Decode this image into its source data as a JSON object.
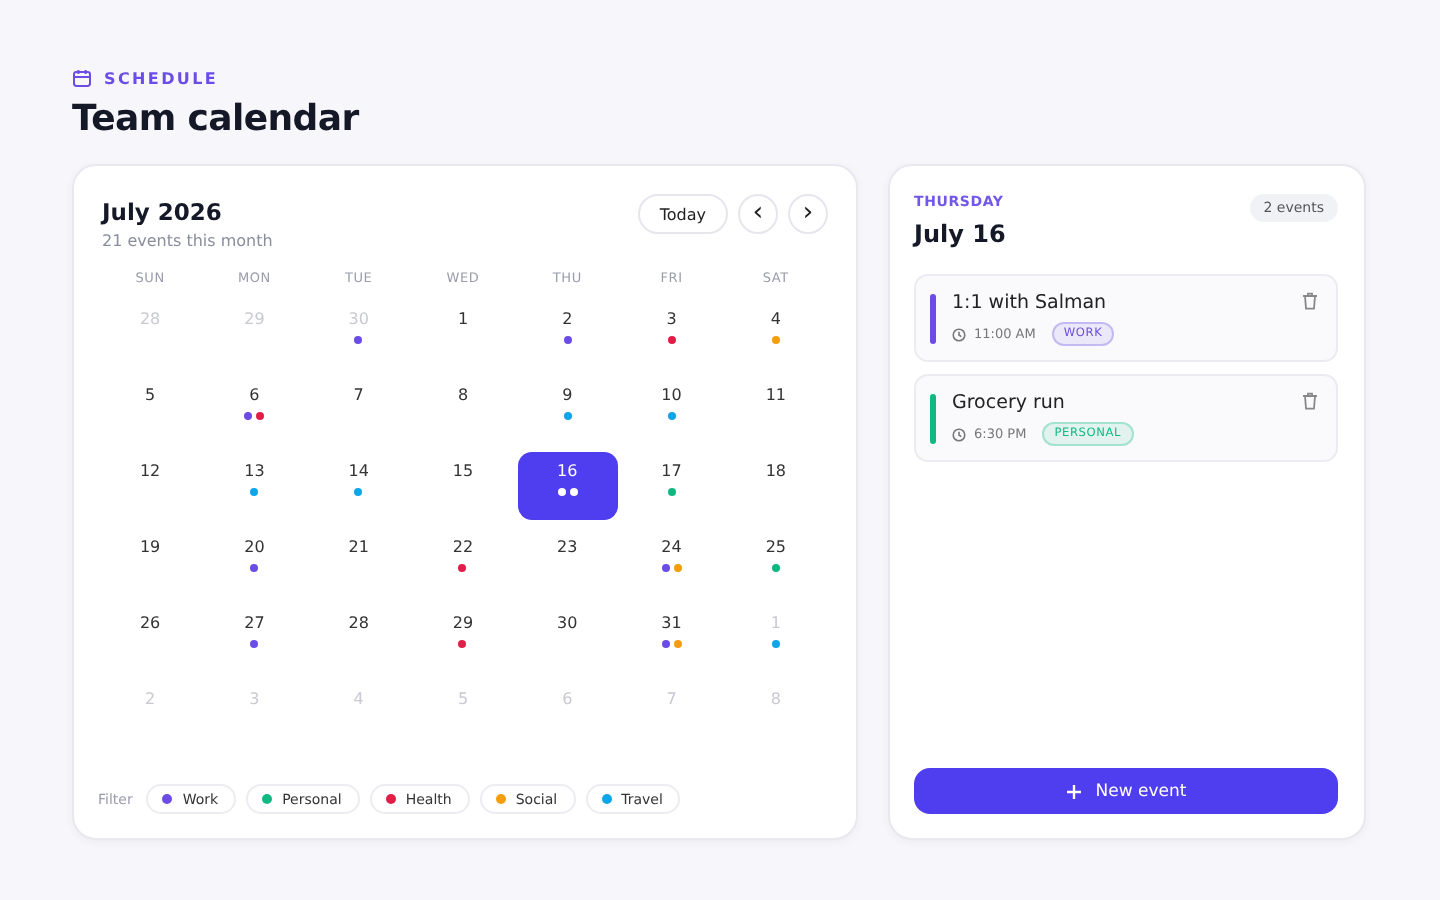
{
  "header": {
    "eyebrow": "SCHEDULE",
    "title": "Team calendar"
  },
  "calendar": {
    "month": "July 2026",
    "summary": "21 events this month",
    "today_button": "Today",
    "prev": "‹",
    "next": "›",
    "weekdays": [
      "SUN",
      "MON",
      "TUE",
      "WED",
      "THU",
      "FRI",
      "SAT"
    ],
    "days": [
      {
        "label": "28",
        "muted": true,
        "selected": false
      },
      {
        "label": "29",
        "muted": true,
        "selected": false
      },
      {
        "label": "30",
        "muted": true,
        "selected": false,
        "dots": [
          {
            "color": "#6c4ce6"
          }
        ]
      },
      {
        "label": "1",
        "muted": false,
        "selected": false
      },
      {
        "label": "2",
        "muted": false,
        "selected": false,
        "dots": [
          {
            "color": "#6c4ce6"
          }
        ]
      },
      {
        "label": "3",
        "muted": false,
        "selected": false,
        "dots": [
          {
            "color": "#e11d48"
          }
        ]
      },
      {
        "label": "4",
        "muted": false,
        "selected": false,
        "dots": [
          {
            "color": "#f59e0b"
          }
        ]
      },
      {
        "label": "5",
        "muted": false,
        "selected": false
      },
      {
        "label": "6",
        "muted": false,
        "selected": false,
        "dots": [
          {
            "color": "#6c4ce6"
          },
          {
            "color": "#e11d48"
          }
        ]
      },
      {
        "label": "7",
        "muted": false,
        "selected": false
      },
      {
        "label": "8",
        "muted": false,
        "selected": false
      },
      {
        "label": "9",
        "muted": false,
        "selected": false,
        "dots": [
          {
            "color": "#0ea5e9"
          }
        ]
      },
      {
        "label": "10",
        "muted": false,
        "selected": false,
        "dots": [
          {
            "color": "#0ea5e9"
          }
        ]
      },
      {
        "label": "11",
        "muted": false,
        "selected": false
      },
      {
        "label": "12",
        "muted": false,
        "selected": false
      },
      {
        "label": "13",
        "muted": false,
        "selected": false,
        "dots": [
          {
            "color": "#0ea5e9"
          }
        ]
      },
      {
        "label": "14",
        "muted": false,
        "selected": false,
        "dots": [
          {
            "color": "#0ea5e9"
          }
        ]
      },
      {
        "label": "15",
        "muted": false,
        "selected": false
      },
      {
        "label": "16",
        "muted": false,
        "selected": true,
        "dots": [
          {
            "color": "#ffffff"
          },
          {
            "color": "#ffffff"
          }
        ]
      },
      {
        "label": "17",
        "muted": false,
        "selected": false,
        "dots": [
          {
            "color": "#10b981"
          }
        ]
      },
      {
        "label": "18",
        "muted": false,
        "selected": false
      },
      {
        "label": "19",
        "muted": false,
        "selected": false
      },
      {
        "label": "20",
        "muted": false,
        "selected": false,
        "dots": [
          {
            "color": "#6c4ce6"
          }
        ]
      },
      {
        "label": "21",
        "muted": false,
        "selected": false
      },
      {
        "label": "22",
        "muted": false,
        "selected": false,
        "dots": [
          {
            "color": "#e11d48"
          }
        ]
      },
      {
        "label": "23",
        "muted": false,
        "selected": false
      },
      {
        "label": "24",
        "muted": false,
        "selected": false,
        "dots": [
          {
            "color": "#6c4ce6"
          },
          {
            "color": "#f59e0b"
          }
        ]
      },
      {
        "label": "25",
        "muted": false,
        "selected": false,
        "dots": [
          {
            "color": "#10b981"
          }
        ]
      },
      {
        "label": "26",
        "muted": false,
        "selected": false
      },
      {
        "label": "27",
        "muted": false,
        "selected": false,
        "dots": [
          {
            "color": "#6c4ce6"
          }
        ]
      },
      {
        "label": "28",
        "muted": false,
        "selected": false
      },
      {
        "label": "29",
        "muted": false,
        "selected": false,
        "dots": [
          {
            "color": "#e11d48"
          }
        ]
      },
      {
        "label": "30",
        "muted": false,
        "selected": false
      },
      {
        "label": "31",
        "muted": false,
        "selected": false,
        "dots": [
          {
            "color": "#6c4ce6"
          },
          {
            "color": "#f59e0b"
          }
        ]
      },
      {
        "label": "1",
        "muted": true,
        "selected": false,
        "dots": [
          {
            "color": "#0ea5e9"
          }
        ]
      },
      {
        "label": "2",
        "muted": true,
        "selected": false
      },
      {
        "label": "3",
        "muted": true,
        "selected": false
      },
      {
        "label": "4",
        "muted": true,
        "selected": false
      },
      {
        "label": "5",
        "muted": true,
        "selected": false
      },
      {
        "label": "6",
        "muted": true,
        "selected": false
      },
      {
        "label": "7",
        "muted": true,
        "selected": false
      },
      {
        "label": "8",
        "muted": true,
        "selected": false
      }
    ],
    "filter_label": "Filter",
    "filters": [
      {
        "label": "Work",
        "color": "#6c4ce6"
      },
      {
        "label": "Personal",
        "color": "#10b981"
      },
      {
        "label": "Health",
        "color": "#e11d48"
      },
      {
        "label": "Social",
        "color": "#f59e0b"
      },
      {
        "label": "Travel",
        "color": "#0ea5e9"
      }
    ]
  },
  "day_panel": {
    "weekday": "THURSDAY",
    "date": "July 16",
    "count": "2 events",
    "events": [
      {
        "title": "1:1 with Salman",
        "time": "11:00 AM",
        "tag": "WORK",
        "color": "#6c4ce6"
      },
      {
        "title": "Grocery run",
        "time": "6:30 PM",
        "tag": "PERSONAL",
        "color": "#10b981"
      }
    ],
    "new_button": "New event"
  }
}
